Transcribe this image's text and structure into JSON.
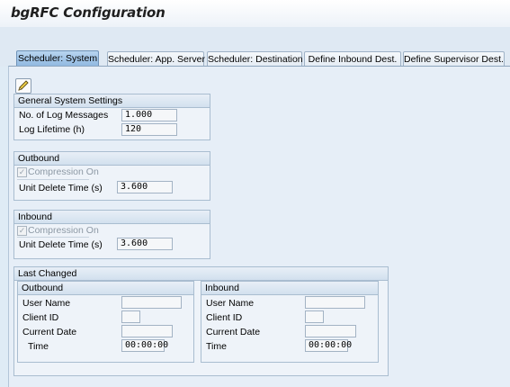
{
  "window": {
    "title": "bgRFC Configuration"
  },
  "tabs": [
    {
      "label": "Scheduler: System",
      "active": true
    },
    {
      "label": "Scheduler: App. Server"
    },
    {
      "label": "Scheduler: Destination"
    },
    {
      "label": "Define Inbound Dest."
    },
    {
      "label": "Define Supervisor Dest."
    }
  ],
  "toolbar": {
    "edit_icon": "pencil-icon"
  },
  "general": {
    "title": "General System Settings",
    "log_messages_label": "No. of Log Messages",
    "log_messages_value": "1.000",
    "log_lifetime_label": "Log Lifetime (h)",
    "log_lifetime_value": "120"
  },
  "outbound": {
    "title": "Outbound",
    "compression_label": "Compression On",
    "compression_checked": true,
    "unit_delete_label": "Unit Delete Time (s)",
    "unit_delete_value": "3.600"
  },
  "inbound": {
    "title": "Inbound",
    "compression_label": "Compression On",
    "compression_checked": true,
    "unit_delete_label": "Unit Delete Time (s)",
    "unit_delete_value": "3.600"
  },
  "last_changed": {
    "title": "Last Changed",
    "outbound": {
      "title": "Outbound",
      "user_name_label": "User Name",
      "user_name_value": "",
      "client_id_label": "Client ID",
      "client_id_value": "",
      "current_date_label": "Current Date",
      "current_date_value": "",
      "time_label": "Time",
      "time_value": "00:00:00"
    },
    "inbound": {
      "title": "Inbound",
      "user_name_label": "User Name",
      "user_name_value": "",
      "client_id_label": "Client ID",
      "client_id_value": "",
      "current_date_label": "Current Date",
      "current_date_value": "",
      "time_label": "Time",
      "time_value": "00:00:00"
    }
  },
  "colors": {
    "active_tab": "#8fb8e0",
    "background": "#dfebf5",
    "group_border": "#a9bdd0"
  }
}
